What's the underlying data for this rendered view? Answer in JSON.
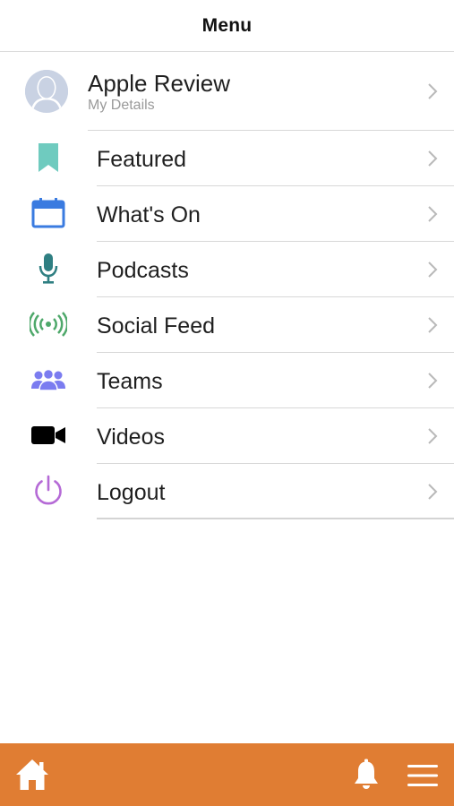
{
  "header": {
    "title": "Menu"
  },
  "profile": {
    "name": "Apple Review",
    "subtitle": "My Details",
    "icon": "user-avatar-icon"
  },
  "menu": {
    "items": [
      {
        "label": "Featured",
        "icon": "bookmark-icon",
        "color": "#6fcbbf"
      },
      {
        "label": "What's On",
        "icon": "calendar-icon",
        "color": "#3a7be0"
      },
      {
        "label": "Podcasts",
        "icon": "microphone-icon",
        "color": "#2f7f82"
      },
      {
        "label": "Social Feed",
        "icon": "broadcast-icon",
        "color": "#4ea86a"
      },
      {
        "label": "Teams",
        "icon": "team-icon",
        "color": "#7b7cf0"
      },
      {
        "label": "Videos",
        "icon": "video-camera-icon",
        "color": "#000000"
      },
      {
        "label": "Logout",
        "icon": "power-icon",
        "color": "#b56ad6"
      }
    ]
  },
  "bottom_bar": {
    "color": "#e07d33",
    "home_icon": "home-icon",
    "notifications_icon": "bell-icon",
    "menu_icon": "hamburger-menu-icon"
  }
}
